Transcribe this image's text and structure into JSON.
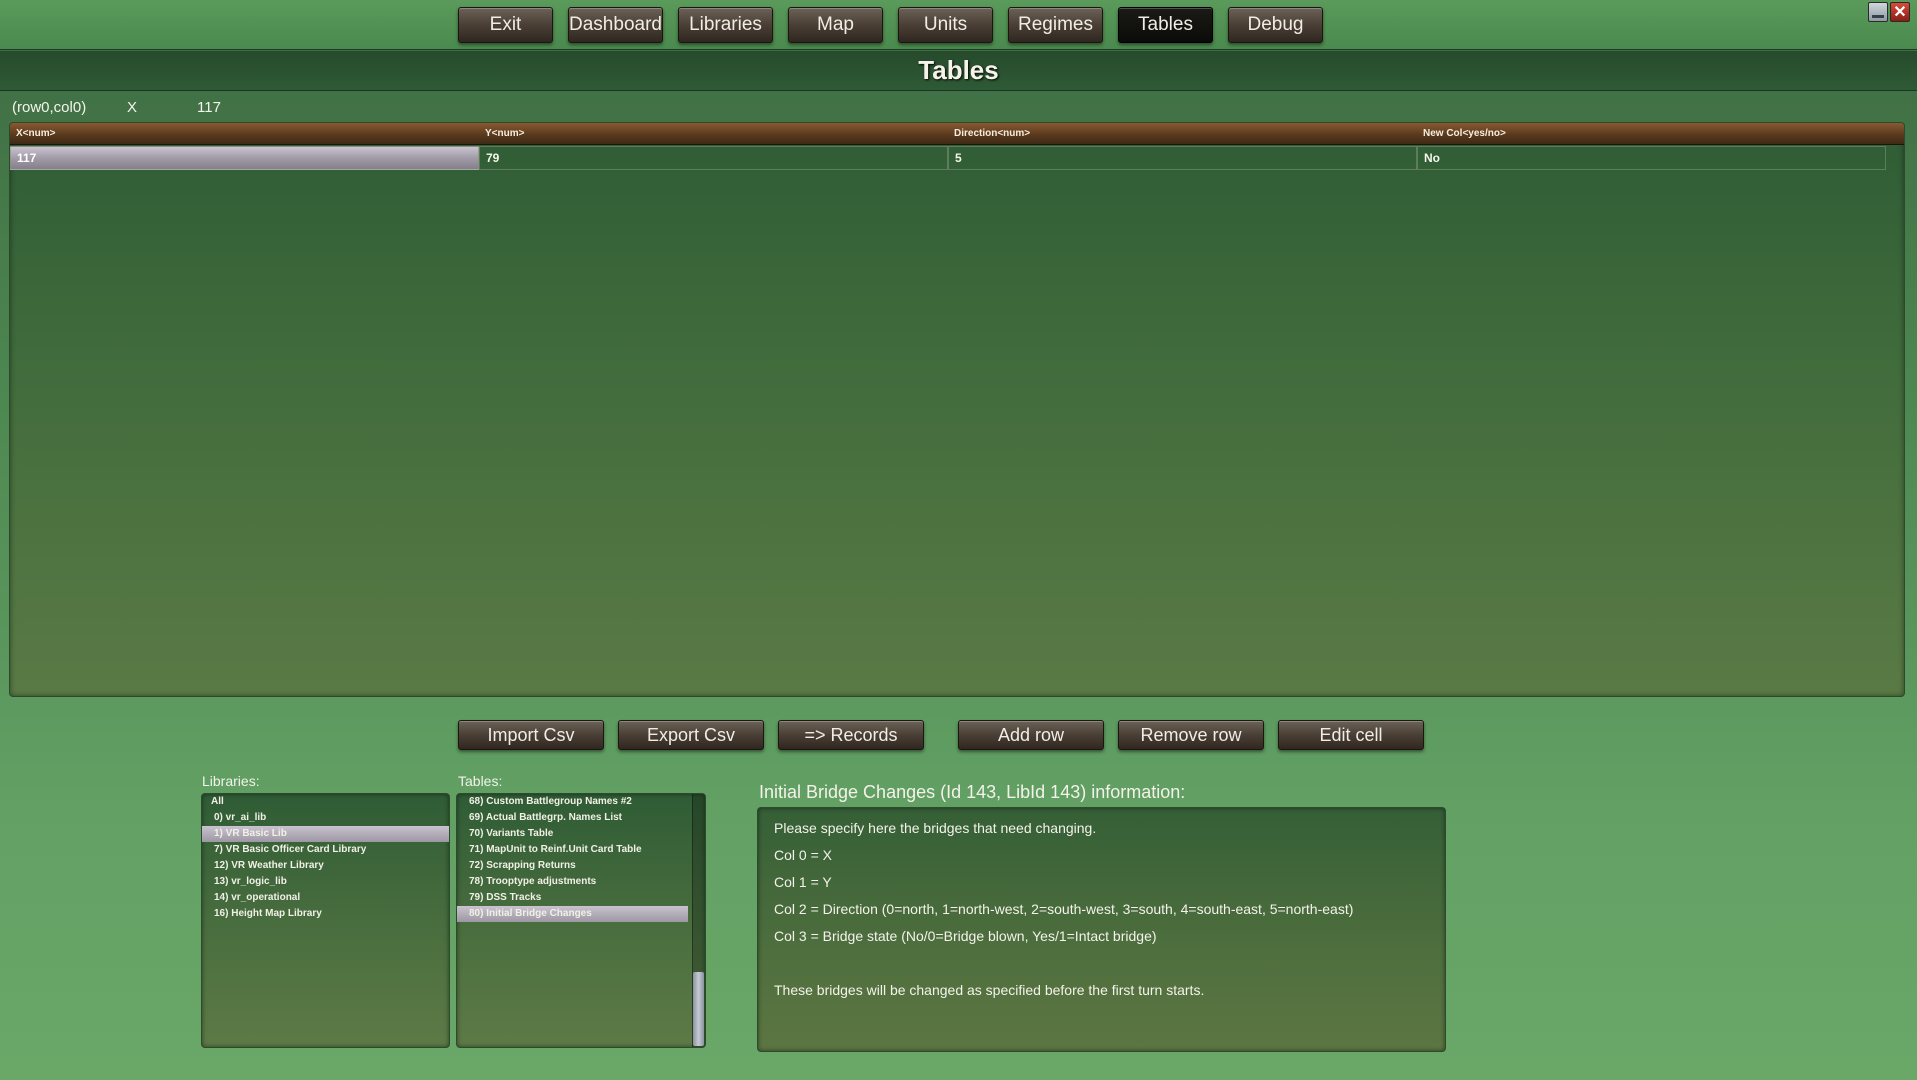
{
  "nav": {
    "items": [
      {
        "label": "Exit"
      },
      {
        "label": "Dashboard"
      },
      {
        "label": "Libraries"
      },
      {
        "label": "Map"
      },
      {
        "label": "Units"
      },
      {
        "label": "Regimes"
      },
      {
        "label": "Tables",
        "active": true
      },
      {
        "label": "Debug"
      }
    ]
  },
  "window": {
    "close_icon": "close-icon",
    "minimize_icon": "minimize-icon",
    "close_glyph": "✕"
  },
  "page": {
    "title": "Tables"
  },
  "cell_info": {
    "position": "(row0,col0)",
    "column": "X",
    "value": "117"
  },
  "grid": {
    "headers": [
      "X<num>",
      "Y<num>",
      "Direction<num>",
      "New Col<yes/no>"
    ],
    "rows": [
      [
        "117",
        "79",
        "5",
        "No"
      ]
    ],
    "selected_row": 0,
    "selected_col": 0
  },
  "actions": {
    "import_csv": "Import Csv",
    "export_csv": "Export Csv",
    "records": "=> Records",
    "add_row": "Add row",
    "remove_row": "Remove row",
    "edit_cell": "Edit cell"
  },
  "libraries": {
    "label": "Libraries:",
    "items": [
      "All",
      "0) vr_ai_lib",
      "1) VR Basic Lib",
      "7) VR Basic Officer Card Library",
      "12) VR Weather Library",
      "13) vr_logic_lib",
      "14) vr_operational",
      "16) Height Map Library"
    ],
    "selected_index": 2
  },
  "tables": {
    "label": "Tables:",
    "items": [
      "68) Custom Battlegroup Names #2",
      "69) Actual Battlegrp. Names List",
      "70) Variants Table",
      "71) MapUnit to Reinf.Unit Card Table",
      "72) Scrapping Returns",
      "78) Trooptype adjustments",
      "79) DSS Tracks",
      "80) Initial Bridge Changes"
    ],
    "selected_index": 7
  },
  "info": {
    "title": "Initial Bridge Changes (Id 143, LibId 143) information:",
    "lines": [
      "Please specify here the bridges that need changing.",
      "Col 0 = X",
      "Col 1 = Y",
      "Col 2 = Direction (0=north, 1=north-west, 2=south-west, 3=south, 4=south-east, 5=north-east)",
      "Col 3 = Bridge state (No/0=Bridge blown, Yes/1=Intact bridge)",
      "",
      "These bridges will be changed as specified before the first turn starts."
    ]
  }
}
